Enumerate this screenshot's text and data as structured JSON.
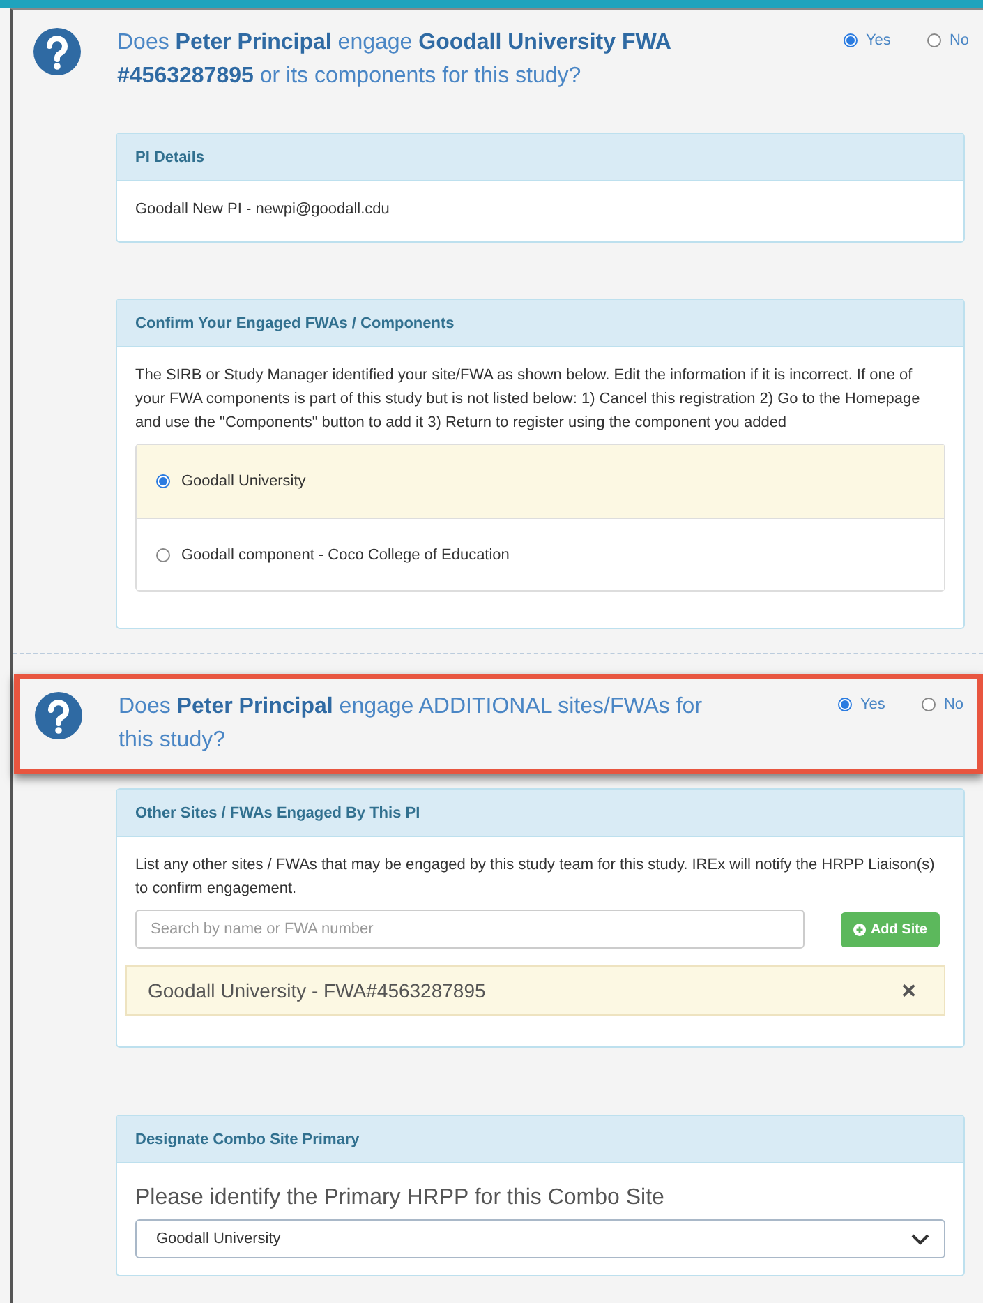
{
  "questions": [
    {
      "text": "Does **Peter Principal** engage **Goodall University FWA #4563287895** or its components for this study?",
      "highlighted": false,
      "options": [
        {
          "label": "Yes",
          "selected": true
        },
        {
          "label": "No",
          "selected": false
        }
      ]
    },
    {
      "text": "Does **Peter Principal** engage ADDITIONAL sites/FWAs for this study?",
      "highlighted": true,
      "options": [
        {
          "label": "Yes",
          "selected": true
        },
        {
          "label": "No",
          "selected": false
        }
      ]
    }
  ],
  "pi_details": {
    "title": "PI Details",
    "value": "Goodall New PI - newpi@goodall.cdu"
  },
  "confirm_fwas": {
    "title": "Confirm Your Engaged FWAs / Components",
    "description": "The SIRB or Study Manager identified your site/FWA as shown below. Edit the information if it is incorrect. If one of your FWA components is part of this study but is not listed below: 1) Cancel this registration 2) Go to the Homepage and use the \"Components\" button to add it 3) Return to register using the component you added",
    "choices": [
      {
        "label": "Goodall University",
        "selected": true
      },
      {
        "label": "Goodall component - Coco College of Education",
        "selected": false
      }
    ]
  },
  "other_sites": {
    "title": "Other Sites / FWAs Engaged By This PI",
    "description": "List any other sites / FWAs that may be engaged by this study team for this study. IREx will notify the HRPP Liaison(s) to confirm engagement.",
    "search": {
      "placeholder": "Search by name or FWA number"
    },
    "add_button": "Add Site",
    "added": [
      {
        "label": "Goodall University - FWA#4563287895",
        "remove": "×"
      }
    ]
  },
  "combo_primary": {
    "title": "Designate Combo Site Primary",
    "label": "Please identify the Primary HRPP for this Combo Site",
    "select_value": "Goodall University"
  }
}
